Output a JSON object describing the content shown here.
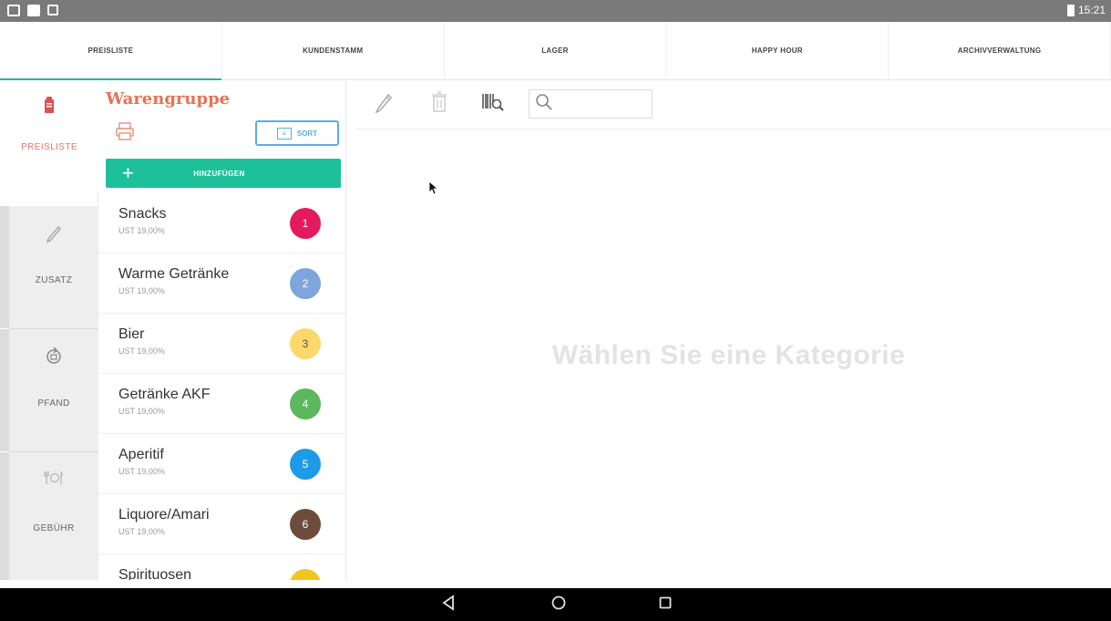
{
  "status_bar": {
    "time": "15:21"
  },
  "tabs": [
    {
      "label": "PREISLISTE",
      "active": true
    },
    {
      "label": "KUNDENSTAMM",
      "active": false
    },
    {
      "label": "LAGER",
      "active": false
    },
    {
      "label": "HAPPY HOUR",
      "active": false
    },
    {
      "label": "ARCHIVVERWALTUNG",
      "active": false
    }
  ],
  "rail": {
    "items": [
      {
        "label": "PREISLISTE",
        "icon": "document-icon",
        "active": true
      },
      {
        "label": "ZUSATZ",
        "icon": "pencil-icon",
        "active": false
      },
      {
        "label": "PFAND",
        "icon": "refresh-icon",
        "active": false
      },
      {
        "label": "GEBÜHR",
        "icon": "cutlery-icon",
        "active": false
      }
    ]
  },
  "category_panel": {
    "title": "Warengruppe",
    "sort_label": "SORT",
    "add_label": "HINZUFÜGEN",
    "categories": [
      {
        "name": "Snacks",
        "tax": "UST 19,00%",
        "badge": "1",
        "color": "#e5195e"
      },
      {
        "name": "Warme Getränke",
        "tax": "UST 19,00%",
        "badge": "2",
        "color": "#7ea6dd"
      },
      {
        "name": "Bier",
        "tax": "UST 19,00%",
        "badge": "3",
        "color": "#fcd86c"
      },
      {
        "name": "Getränke AKF",
        "tax": "UST 19,00%",
        "badge": "4",
        "color": "#5cb85c"
      },
      {
        "name": "Aperitif",
        "tax": "UST 19,00%",
        "badge": "5",
        "color": "#1e9be8"
      },
      {
        "name": "Liquore/Amari",
        "tax": "UST 19,00%",
        "badge": "6",
        "color": "#6d4c3d"
      },
      {
        "name": "Spirituosen",
        "tax": "",
        "badge": "",
        "color": "#f2c420"
      }
    ]
  },
  "main": {
    "search_placeholder": "",
    "empty_message": "Wählen Sie eine Kategorie"
  },
  "colors": {
    "accent": "#26b5a0",
    "add_button": "#1ec09a",
    "title": "#e57355",
    "sort_border": "#5aaee0"
  }
}
